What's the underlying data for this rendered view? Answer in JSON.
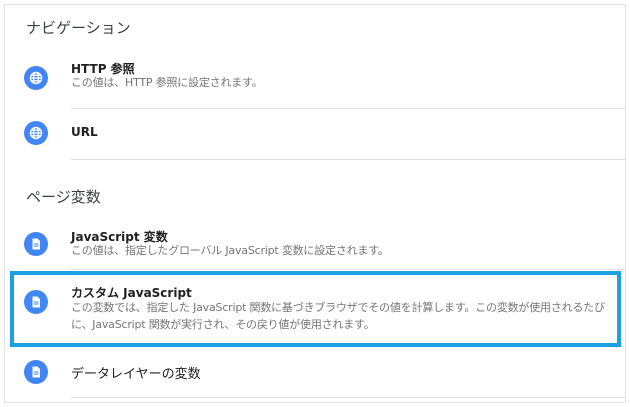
{
  "navigation": {
    "section_title": "ナビゲーション",
    "items": [
      {
        "icon": "globe-icon",
        "title": "HTTP 参照",
        "description": "この値は、HTTP 参照に設定されます。"
      },
      {
        "icon": "globe-icon",
        "title": "URL"
      }
    ]
  },
  "page_variables": {
    "section_title": "ページ変数",
    "items": [
      {
        "icon": "document-icon",
        "title": "JavaScript 変数",
        "description": "この値は、指定したグローバル JavaScript 変数に設定されます。"
      },
      {
        "icon": "document-icon",
        "title": "カスタム JavaScript",
        "description": "この変数では、指定した JavaScript 関数に基づきブラウザでその値を計算します。この変数が使用されるたびに、JavaScript 関数が実行され、その戻り値が使用されます。",
        "selected": true
      },
      {
        "icon": "document-icon",
        "title": "データレイヤーの変数"
      }
    ]
  },
  "colors": {
    "icon_blue": "#4285f4",
    "highlight_border": "#1ba1e2"
  }
}
